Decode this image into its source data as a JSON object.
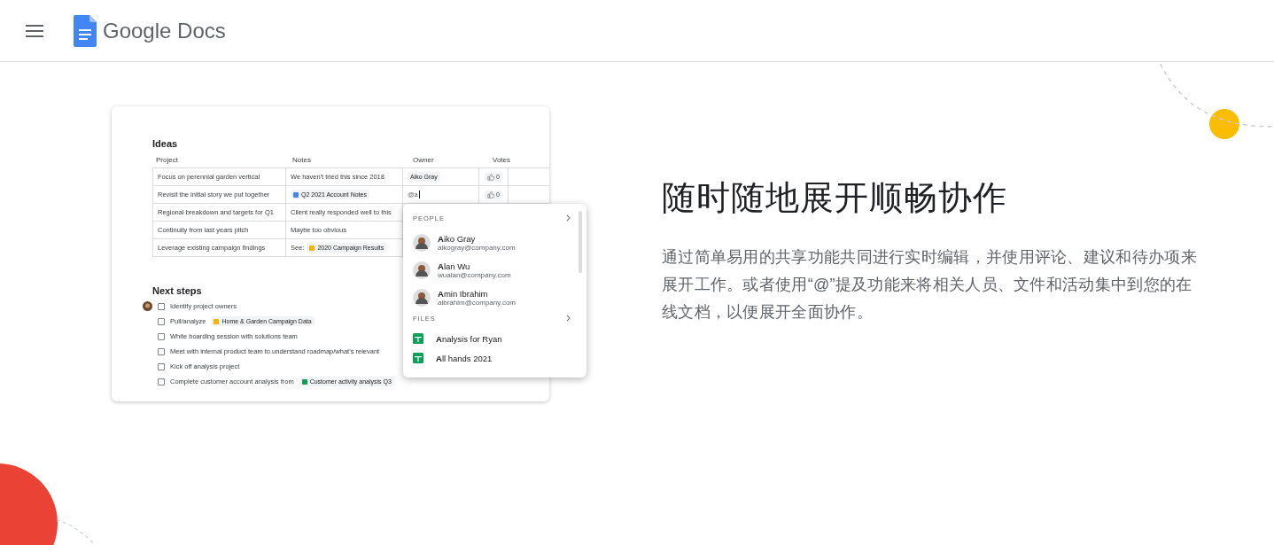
{
  "header": {
    "product": "Google Docs"
  },
  "ideas": {
    "title": "Ideas",
    "columns": [
      "Project",
      "Notes",
      "Owner",
      "Votes"
    ],
    "rows": [
      {
        "project": "Focus on perennial garden vertical",
        "notes": {
          "text": "We haven't tried this since 2018"
        },
        "owner": {
          "kind": "chip",
          "text": "Aiko Gray"
        },
        "votes": "0"
      },
      {
        "project": "Revisit the initial story we put together",
        "notes": {
          "chip": {
            "kind": "doc",
            "label": "Q2 2021 Account Notes"
          }
        },
        "owner": {
          "kind": "typing",
          "text": "@a"
        },
        "votes": "0"
      },
      {
        "project": "Regional breakdown and targets for Q1",
        "notes": {
          "text": "Client really responded well to this"
        }
      },
      {
        "project": "Continuity from last years pitch",
        "notes": {
          "text": "Maybe too obvious"
        }
      },
      {
        "project": "Leverage existing campaign findings",
        "notes": {
          "text": "See:",
          "chip": {
            "kind": "slides",
            "label": "2020 Campaign Results"
          }
        }
      }
    ]
  },
  "next_steps": {
    "title": "Next steps",
    "items": [
      {
        "text": "Identify project owners",
        "checked": false,
        "assigned": true
      },
      {
        "text": "Pull/analyze",
        "checked": false,
        "assigned": false,
        "chip": {
          "kind": "slides",
          "label": "Home & Garden Campaign Data"
        }
      },
      {
        "text": "White boarding session with solutions team",
        "checked": false,
        "assigned": false
      },
      {
        "text": "Meet with internal product team to understand roadmap/what's relevant",
        "checked": false,
        "assigned": false
      },
      {
        "text": "Kick off analysis project",
        "checked": false,
        "assigned": false
      },
      {
        "text": "Complete customer account analysis from",
        "checked": false,
        "assigned": false,
        "chip": {
          "kind": "sheets",
          "label": "Customer activity analysis Q3"
        }
      }
    ]
  },
  "mention_menu": {
    "people_heading": "PEOPLE",
    "people": [
      {
        "name": "**A**iko Gray",
        "email": "aikogray@company.com"
      },
      {
        "name": "**A**lan Wu",
        "email": "wualan@company.com"
      },
      {
        "name": "**A**min Ibrahim",
        "email": "aibrahim@company.com"
      }
    ],
    "files_heading": "FILES",
    "files": [
      {
        "kind": "sheets",
        "name": "**A**nalysis for Ryan"
      },
      {
        "kind": "sheets",
        "name": "**A**ll hands 2021"
      }
    ]
  },
  "feature": {
    "heading": "随时随地展开顺畅协作",
    "body": "通过简单易用的共享功能共同进行实时编辑，并使用评论、建议和待办项来展开工作。或者使用“@”提及功能来将相关人员、文件和活动集中到您的在线文档，以便展开全面协作。"
  }
}
